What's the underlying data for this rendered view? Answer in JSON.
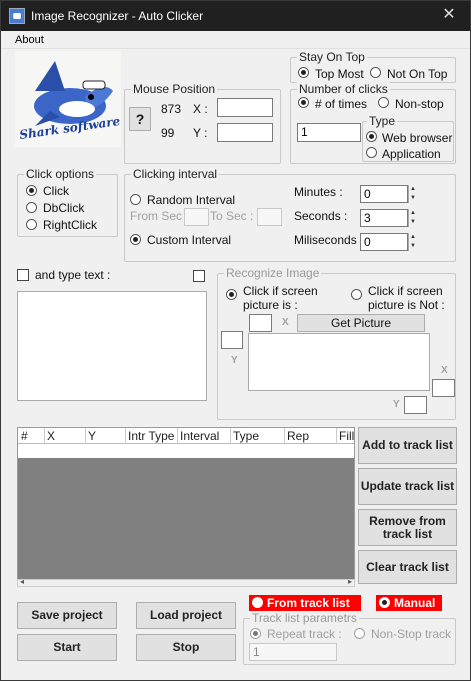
{
  "window": {
    "title": "Image Recognizer - Auto Clicker",
    "close_glyph": "✕"
  },
  "menu": {
    "about": "About"
  },
  "logo": {
    "text": "Shark software"
  },
  "mouse_position": {
    "legend": "Mouse Position",
    "pick_icon": "?",
    "x_value": "873",
    "y_value": "99",
    "x_label": "X :",
    "y_label": "Y :",
    "x_field": "",
    "y_field": ""
  },
  "stay_on_top": {
    "legend": "Stay On Top",
    "top_most": "Top Most",
    "not_on_top": "Not On Top",
    "selected": "top_most"
  },
  "number_of_clicks": {
    "legend": "Number of clicks",
    "num_times": "# of times",
    "non_stop": "Non-stop",
    "count": "1"
  },
  "type": {
    "legend": "Type",
    "web_browser": "Web browser",
    "application": "Application"
  },
  "click_options": {
    "legend": "Click options",
    "click": "Click",
    "dbl": "DbClick",
    "right": "RightClick"
  },
  "clicking_interval": {
    "legend": "Clicking interval",
    "random": "Random Interval",
    "from": "From Sec :",
    "to": "To Sec :",
    "custom": "Custom Interval",
    "minutes_label": "Minutes :",
    "seconds_label": "Seconds :",
    "ms_label": "Miliseconds :",
    "minutes": "0",
    "seconds": "3",
    "ms": "0"
  },
  "type_text": {
    "label": "and type text :",
    "value": ""
  },
  "recognize": {
    "legend": "Recognize Image",
    "is": "Click if screen picture is :",
    "is_not": "Click if screen picture is Not :",
    "x": "X",
    "y": "Y",
    "get_picture": "Get Picture"
  },
  "table": {
    "columns": [
      "#",
      "X",
      "Y",
      "Intr Type",
      "Interval",
      "Type",
      "Rep",
      "Fill"
    ]
  },
  "track_buttons": {
    "add": "Add to track list",
    "update": "Update track list",
    "remove": "Remove from track list",
    "clear": "Clear track list"
  },
  "project": {
    "save": "Save project",
    "load": "Load project",
    "start": "Start",
    "stop": "Stop"
  },
  "mode": {
    "from_track": "From track list",
    "manual": "Manual"
  },
  "track_params": {
    "legend": "Track list parametrs",
    "repeat": "Repeat track :",
    "non_stop": "Non-Stop track",
    "repeat_value": "1"
  }
}
